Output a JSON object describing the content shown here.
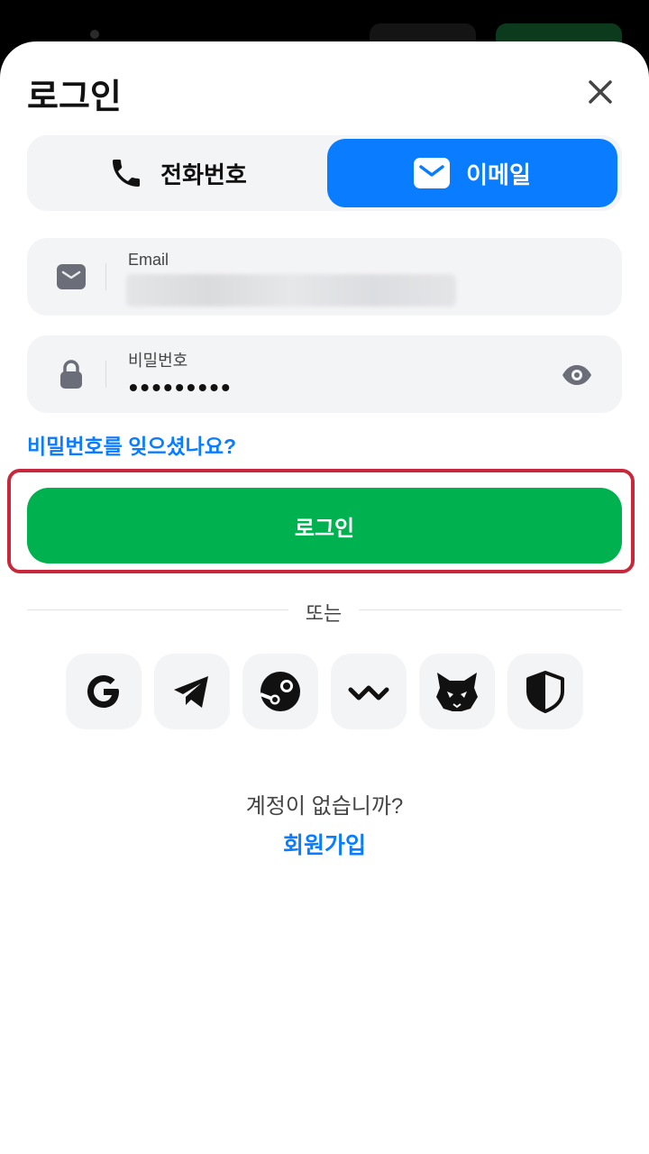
{
  "header": {
    "title": "로그인"
  },
  "tabs": [
    {
      "label": "전화번호",
      "icon": "phone-icon",
      "selected": false
    },
    {
      "label": "이메일",
      "icon": "mail-icon",
      "selected": true
    }
  ],
  "email_field": {
    "label": "Email",
    "value": ""
  },
  "password_field": {
    "label": "비밀번호",
    "value": "•••••••••"
  },
  "forgot_password": "비밀번호를 잊으셨나요?",
  "login_button": "로그인",
  "divider_text": "또는",
  "social_logins": [
    "google-icon",
    "telegram-icon",
    "steam-icon",
    "walletconnect-icon",
    "metamask-icon",
    "shield-icon"
  ],
  "footer": {
    "no_account": "계정이 없습니까?",
    "signup": "회원가입"
  },
  "colors": {
    "accent": "#0a7cff",
    "primary": "#00b14f",
    "highlight": "#c8283c",
    "field_bg": "#f3f4f6"
  }
}
